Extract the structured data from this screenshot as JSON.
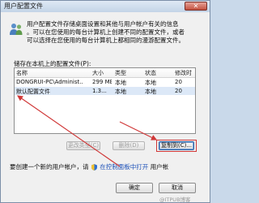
{
  "window": {
    "title": "用户配置文件",
    "close_glyph": "✕"
  },
  "description": [
    "用户配置文件存储桌面设置和其他与用户帐户有关的信息",
    "。可以在您使用的每台计算机上创建不同的配置文件，或者",
    "可以选择在您使用的每台计算机上都相同的漫游配置文件。"
  ],
  "stored_label": "储存在本机上的配置文件(P):",
  "table": {
    "columns": [
      "名称",
      "大小",
      "类型",
      "状态",
      "修改时"
    ],
    "rows": [
      {
        "name": "DONGRUI-PC\\Administ...",
        "size": "299 MB",
        "type": "本地",
        "status": "本地",
        "modified": "20"
      },
      {
        "name": "默认配置文件",
        "size": "1.3...",
        "type": "本地",
        "status": "本地",
        "modified": "20"
      }
    ]
  },
  "buttons": {
    "change_type": "更改类型(C)",
    "delete": "删除(D)",
    "copy_to": "复制到(C)..."
  },
  "new_user": {
    "prefix": "要创建一个新的用户帐户，请",
    "link": "在控制面板中打开",
    "suffix": "用户帐"
  },
  "footer": {
    "ok": "确定",
    "cancel": "取消"
  },
  "watermark": "@ITPUB博客",
  "colors": {
    "annotation_red": "#d03838",
    "link_blue": "#1b4fb8"
  },
  "icons": [
    "users-icon",
    "close-icon",
    "shield-icon"
  ]
}
